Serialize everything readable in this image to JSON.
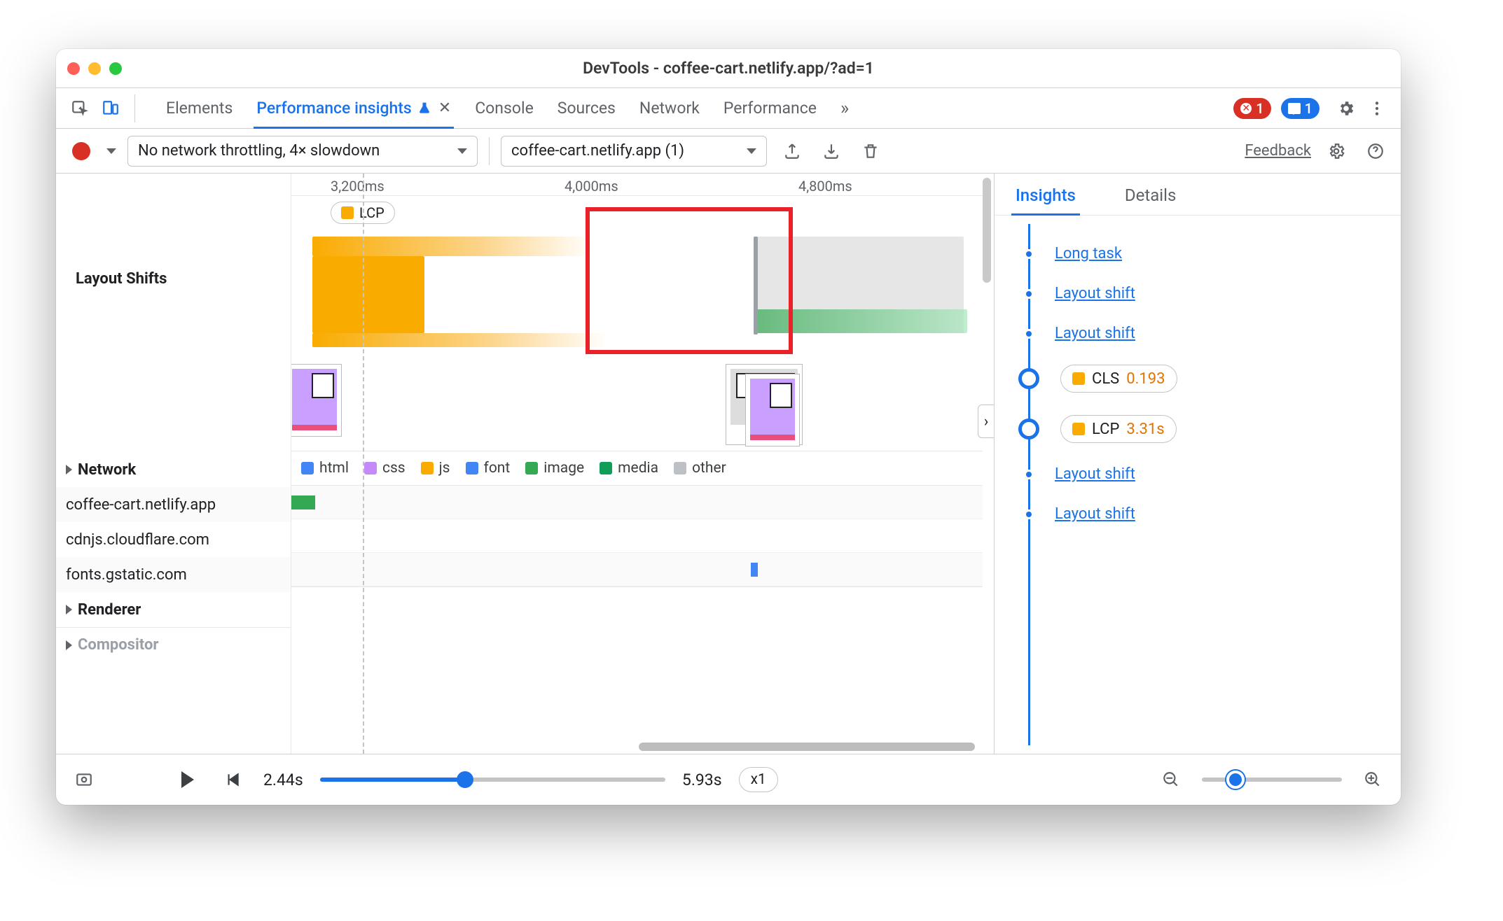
{
  "window_title": "DevTools - coffee-cart.netlify.app/?ad=1",
  "panel_tabs": {
    "elements": "Elements",
    "perf_insights": "Performance insights",
    "console": "Console",
    "sources": "Sources",
    "network": "Network",
    "performance": "Performance"
  },
  "error_badge_count": "1",
  "message_badge_count": "1",
  "toolbar": {
    "throttle": "No network throttling, 4× slowdown",
    "recording": "coffee-cart.netlify.app (1)",
    "feedback": "Feedback"
  },
  "ruler": {
    "t1": "3,200ms",
    "t2": "4,000ms",
    "t3": "4,800ms"
  },
  "lcp_chip": "LCP",
  "track_labels": {
    "layout_shifts": "Layout Shifts",
    "network": "Network",
    "renderer": "Renderer",
    "compositor": "Compositor"
  },
  "legend": {
    "html": "html",
    "css": "css",
    "js": "js",
    "font": "font",
    "image": "image",
    "media": "media",
    "other": "other"
  },
  "network_hosts": {
    "h0": "coffee-cart.netlify.app",
    "h1": "cdnjs.cloudflare.com",
    "h2": "fonts.gstatic.com"
  },
  "insights": {
    "tab_insights": "Insights",
    "tab_details": "Details",
    "items": {
      "long_task": "Long task",
      "layout_shift": "Layout shift",
      "cls_label": "CLS",
      "cls_value": "0.193",
      "lcp_label": "LCP",
      "lcp_value": "3.31s"
    }
  },
  "bottom": {
    "t_start": "2.44s",
    "t_end": "5.93s",
    "speed": "x1"
  }
}
